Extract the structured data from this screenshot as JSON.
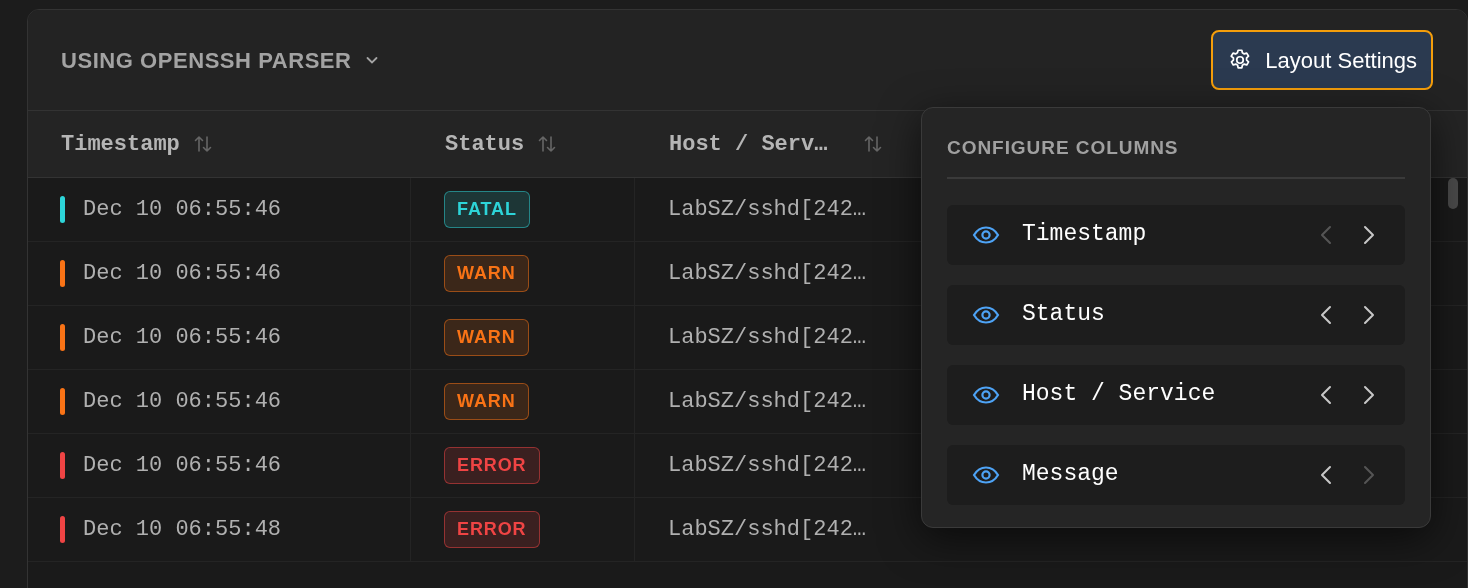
{
  "parser_menu": {
    "label": "USING OPENSSH PARSER"
  },
  "layout_button": {
    "label": "Layout Settings"
  },
  "table": {
    "columns": [
      {
        "label": "Timestamp"
      },
      {
        "label": "Status"
      },
      {
        "label": "Host / Serv…"
      }
    ],
    "rows": [
      {
        "timestamp": "Dec 10 06:55:46",
        "status": "FATAL",
        "color": "#2dd4d8",
        "host": "LabSZ/sshd[242…"
      },
      {
        "timestamp": "Dec 10 06:55:46",
        "status": "WARN",
        "color": "#f97316",
        "host": "LabSZ/sshd[242…"
      },
      {
        "timestamp": "Dec 10 06:55:46",
        "status": "WARN",
        "color": "#f97316",
        "host": "LabSZ/sshd[242…"
      },
      {
        "timestamp": "Dec 10 06:55:46",
        "status": "WARN",
        "color": "#f97316",
        "host": "LabSZ/sshd[242…"
      },
      {
        "timestamp": "Dec 10 06:55:46",
        "status": "ERROR",
        "color": "#ef4444",
        "host": "LabSZ/sshd[242…"
      },
      {
        "timestamp": "Dec 10 06:55:48",
        "status": "ERROR",
        "color": "#ef4444",
        "host": "LabSZ/sshd[242…"
      }
    ]
  },
  "column_settings": {
    "title": "CONFIGURE COLUMNS",
    "items": [
      {
        "label": "Timestamp",
        "visible": true,
        "can_move_left": false,
        "can_move_right": true
      },
      {
        "label": "Status",
        "visible": true,
        "can_move_left": true,
        "can_move_right": true
      },
      {
        "label": "Host / Service",
        "visible": true,
        "can_move_left": true,
        "can_move_right": true
      },
      {
        "label": "Message",
        "visible": true,
        "can_move_left": true,
        "can_move_right": false
      }
    ]
  }
}
